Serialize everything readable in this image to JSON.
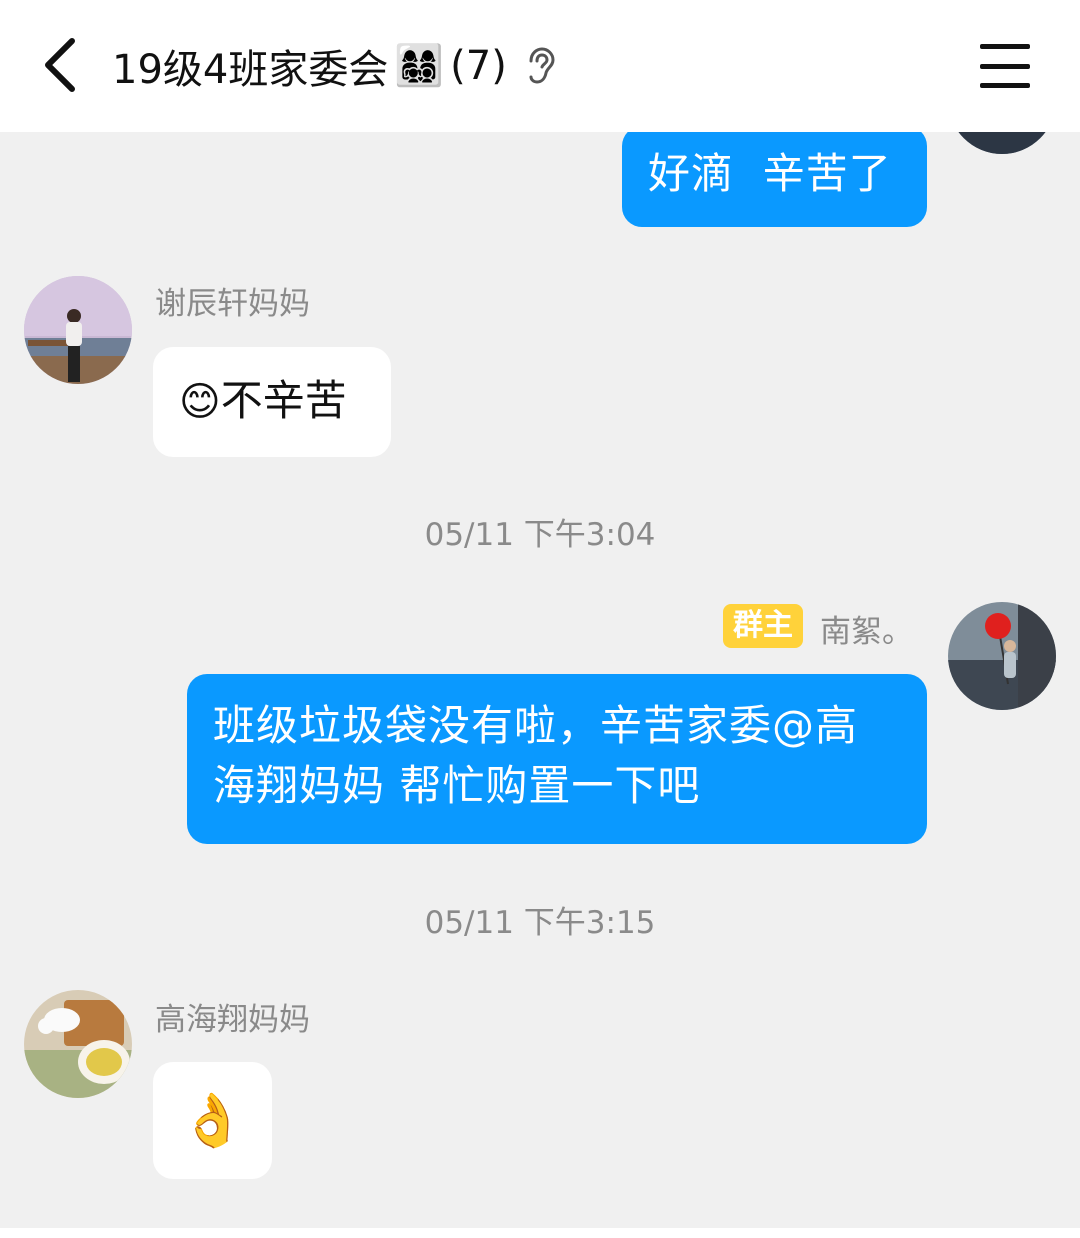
{
  "header": {
    "title": "19级4班家委会",
    "title_emoji": "👩‍👩‍👧‍👦",
    "member_count": "(7)"
  },
  "messages": [
    {
      "text": "好滴  辛苦了"
    },
    {
      "sender": "谢辰轩妈妈",
      "emoji": "😊",
      "text": "不辛苦"
    },
    {
      "timestamp": "05/11 下午3:04"
    },
    {
      "badge": "群主",
      "sender": "南絮。",
      "line1": "班级垃圾袋没有啦，辛苦家委@高",
      "line2": "海翔妈妈 帮忙购置一下吧"
    },
    {
      "timestamp": "05/11 下午3:15"
    },
    {
      "sender": "高海翔妈妈",
      "emoji": "👌"
    }
  ],
  "colors": {
    "accent_blue": "#0a99ff",
    "owner_badge": "#ffd23a",
    "background": "#f0f0f0"
  }
}
